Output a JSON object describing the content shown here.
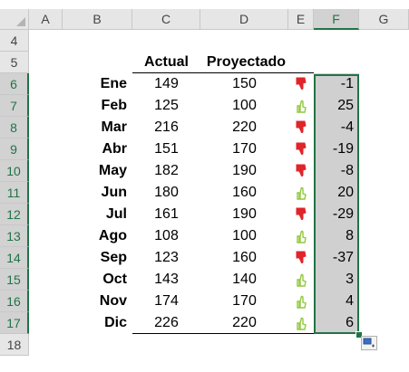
{
  "columns": [
    "A",
    "B",
    "C",
    "D",
    "E",
    "F",
    "G"
  ],
  "selected_column": "F",
  "rows": [
    "4",
    "5",
    "6",
    "7",
    "8",
    "9",
    "10",
    "11",
    "12",
    "13",
    "14",
    "15",
    "16",
    "17",
    "18"
  ],
  "selected_rows": [
    "6",
    "7",
    "8",
    "9",
    "10",
    "11",
    "12",
    "13",
    "14",
    "15",
    "16",
    "17"
  ],
  "table": {
    "header_actual": "Actual",
    "header_projected": "Proyectado",
    "records": [
      {
        "month": "Ene",
        "actual": "149",
        "projected": "150",
        "icon": "thumb-down-icon",
        "diff": "-1"
      },
      {
        "month": "Feb",
        "actual": "125",
        "projected": "100",
        "icon": "thumb-up-icon",
        "diff": "25"
      },
      {
        "month": "Mar",
        "actual": "216",
        "projected": "220",
        "icon": "thumb-down-icon",
        "diff": "-4"
      },
      {
        "month": "Abr",
        "actual": "151",
        "projected": "170",
        "icon": "thumb-down-icon",
        "diff": "-19"
      },
      {
        "month": "May",
        "actual": "182",
        "projected": "190",
        "icon": "thumb-down-icon",
        "diff": "-8"
      },
      {
        "month": "Jun",
        "actual": "180",
        "projected": "160",
        "icon": "thumb-up-icon",
        "diff": "20"
      },
      {
        "month": "Jul",
        "actual": "161",
        "projected": "190",
        "icon": "thumb-down-icon",
        "diff": "-29"
      },
      {
        "month": "Ago",
        "actual": "108",
        "projected": "100",
        "icon": "thumb-up-icon",
        "diff": "8"
      },
      {
        "month": "Sep",
        "actual": "123",
        "projected": "160",
        "icon": "thumb-down-icon",
        "diff": "-37"
      },
      {
        "month": "Oct",
        "actual": "143",
        "projected": "140",
        "icon": "thumb-up-icon",
        "diff": "3"
      },
      {
        "month": "Nov",
        "actual": "174",
        "projected": "170",
        "icon": "thumb-up-icon",
        "diff": "4"
      },
      {
        "month": "Dic",
        "actual": "226",
        "projected": "220",
        "icon": "thumb-up-icon",
        "diff": "6"
      }
    ]
  },
  "colors": {
    "selection": "#217346",
    "thumb_down": "#e0242a",
    "thumb_up": "#92c83e",
    "selected_fill": "#d0d0d0"
  }
}
